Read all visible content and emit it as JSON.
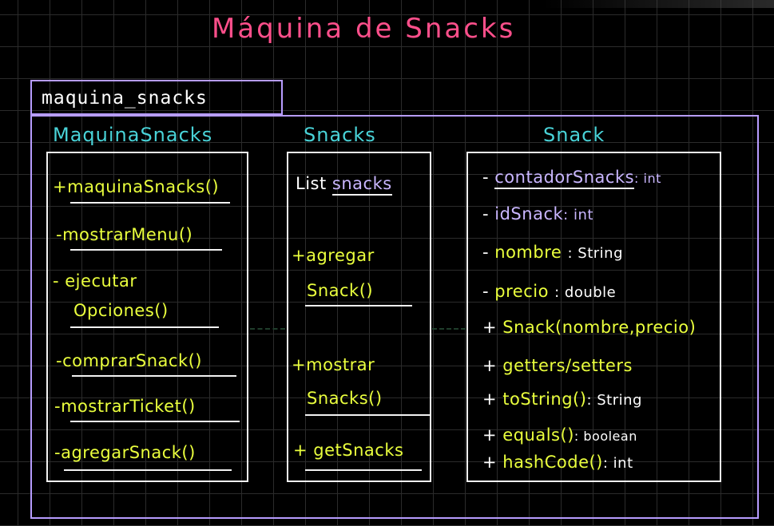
{
  "title": "Máquina de Snacks",
  "package": {
    "name": "maquina_snacks"
  },
  "classes": [
    {
      "name": "MaquinaSnacks",
      "members": [
        {
          "vis": "+",
          "name": "maquinaSnacks()"
        },
        {
          "vis": "-",
          "name": "mostrarMenu()"
        },
        {
          "vis": "-",
          "name": "ejecutar",
          "name2": "Opciones()"
        },
        {
          "vis": "-",
          "name": "comprarSnack()"
        },
        {
          "vis": "-",
          "name": "mostrarTicket()"
        },
        {
          "vis": "-",
          "name": "agregarSnack()"
        }
      ]
    },
    {
      "name": "Snacks",
      "members": [
        {
          "vis": "",
          "prefix": "List",
          "name": "snacks"
        },
        {
          "vis": "+",
          "name": "agregar",
          "name2": "Snack()"
        },
        {
          "vis": "+",
          "name": "mostrar",
          "name2": "Snacks()"
        },
        {
          "vis": "+",
          "name": "getSnacks"
        }
      ]
    },
    {
      "name": "Snack",
      "members": [
        {
          "vis": "-",
          "name": "contadorSnacks",
          "type": ": int"
        },
        {
          "vis": "-",
          "name": "idSnack",
          "type": ": int"
        },
        {
          "vis": "-",
          "name": "nombre",
          "type": ": String"
        },
        {
          "vis": "-",
          "name": "precio",
          "type": ": double"
        },
        {
          "vis": "+",
          "name": "Snack(nombre,precio)"
        },
        {
          "vis": "+",
          "name": "getters/setters"
        },
        {
          "vis": "+",
          "name": "toString()",
          "type": ": String"
        },
        {
          "vis": "+",
          "name": "equals()",
          "type": ": boolean"
        },
        {
          "vis": "+",
          "name": "hashCode()",
          "type": ": int"
        }
      ]
    }
  ],
  "colors": {
    "title": "#ff4f8b",
    "package_border": "#b79cff",
    "class_name": "#49d3d8",
    "member_text": "#eaff3d",
    "grid": "#2b2b2b",
    "background": "#000000"
  }
}
